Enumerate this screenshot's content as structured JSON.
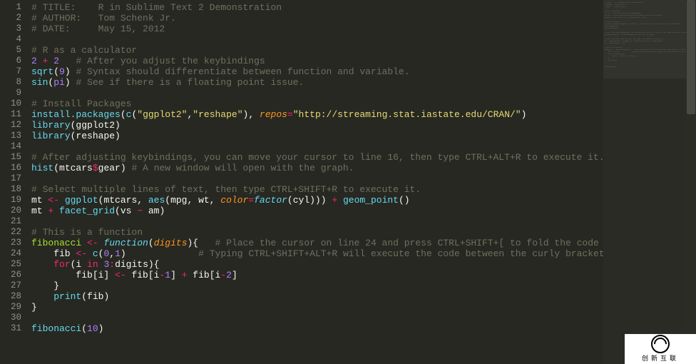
{
  "watermark_text": "创新互联",
  "lines": [
    {
      "n": 1,
      "tokens": [
        [
          "c",
          "# TITLE:    R in Sublime Text 2 Demonstration"
        ]
      ]
    },
    {
      "n": 2,
      "tokens": [
        [
          "c",
          "# AUTHOR:   Tom Schenk Jr."
        ]
      ]
    },
    {
      "n": 3,
      "tokens": [
        [
          "c",
          "# DATE:     May 15, 2012"
        ]
      ]
    },
    {
      "n": 4,
      "tokens": []
    },
    {
      "n": 5,
      "tokens": [
        [
          "c",
          "# R as a calculator"
        ]
      ]
    },
    {
      "n": 6,
      "tokens": [
        [
          "n",
          "2"
        ],
        [
          "p",
          " "
        ],
        [
          "o",
          "+"
        ],
        [
          "p",
          " "
        ],
        [
          "n",
          "2"
        ],
        [
          "p",
          "   "
        ],
        [
          "c",
          "# After you adjust the keybindings"
        ]
      ]
    },
    {
      "n": 7,
      "tokens": [
        [
          "f",
          "sqrt"
        ],
        [
          "p",
          "("
        ],
        [
          "n",
          "9"
        ],
        [
          "p",
          ") "
        ],
        [
          "c",
          "# Syntax should differentiate between function and variable."
        ]
      ]
    },
    {
      "n": 8,
      "tokens": [
        [
          "f",
          "sin"
        ],
        [
          "p",
          "("
        ],
        [
          "n",
          "pi"
        ],
        [
          "p",
          ") "
        ],
        [
          "c",
          "# See if there is a floating point issue."
        ]
      ]
    },
    {
      "n": 9,
      "tokens": []
    },
    {
      "n": 10,
      "tokens": [
        [
          "c",
          "# Install Packages"
        ]
      ]
    },
    {
      "n": 11,
      "tokens": [
        [
          "f",
          "install.packages"
        ],
        [
          "p",
          "("
        ],
        [
          "f",
          "c"
        ],
        [
          "p",
          "("
        ],
        [
          "s",
          "\"ggplot2\""
        ],
        [
          "p",
          ","
        ],
        [
          "s",
          "\"reshape\""
        ],
        [
          "p",
          "), "
        ],
        [
          "pa",
          "repos"
        ],
        [
          "o",
          "="
        ],
        [
          "s",
          "\"http://streaming.stat.iastate.edu/CRAN/\""
        ],
        [
          "p",
          ")"
        ]
      ]
    },
    {
      "n": 12,
      "tokens": [
        [
          "f",
          "library"
        ],
        [
          "p",
          "(ggplot2)"
        ]
      ]
    },
    {
      "n": 13,
      "tokens": [
        [
          "f",
          "library"
        ],
        [
          "p",
          "(reshape)"
        ]
      ]
    },
    {
      "n": 14,
      "tokens": []
    },
    {
      "n": 15,
      "tokens": [
        [
          "c",
          "# After adjusting keybindings, you can move your cursor to line 16, then type CTRL+ALT+R to execute it."
        ]
      ]
    },
    {
      "n": 16,
      "tokens": [
        [
          "f",
          "hist"
        ],
        [
          "p",
          "(mtcars"
        ],
        [
          "o",
          "$"
        ],
        [
          "p",
          "gear) "
        ],
        [
          "c",
          "# A new window will open with the graph."
        ]
      ]
    },
    {
      "n": 17,
      "tokens": []
    },
    {
      "n": 18,
      "tokens": [
        [
          "c",
          "# Select multiple lines of text, then type CTRL+SHIFT+R to execute it."
        ]
      ]
    },
    {
      "n": 19,
      "tokens": [
        [
          "p",
          "mt "
        ],
        [
          "o",
          "<-"
        ],
        [
          "p",
          " "
        ],
        [
          "f",
          "ggplot"
        ],
        [
          "p",
          "(mtcars, "
        ],
        [
          "f",
          "aes"
        ],
        [
          "p",
          "(mpg, wt, "
        ],
        [
          "pa",
          "color"
        ],
        [
          "o",
          "="
        ],
        [
          "t",
          "factor"
        ],
        [
          "p",
          "(cyl))) "
        ],
        [
          "o",
          "+"
        ],
        [
          "p",
          " "
        ],
        [
          "f",
          "geom_point"
        ],
        [
          "p",
          "()"
        ]
      ]
    },
    {
      "n": 20,
      "tokens": [
        [
          "p",
          "mt "
        ],
        [
          "o",
          "+"
        ],
        [
          "p",
          " "
        ],
        [
          "f",
          "facet_grid"
        ],
        [
          "p",
          "(vs "
        ],
        [
          "o",
          "~"
        ],
        [
          "p",
          " am)"
        ]
      ]
    },
    {
      "n": 21,
      "tokens": []
    },
    {
      "n": 22,
      "tokens": [
        [
          "c",
          "# This is a function"
        ]
      ]
    },
    {
      "n": 23,
      "tokens": [
        [
          "d",
          "fibonacci"
        ],
        [
          "p",
          " "
        ],
        [
          "o",
          "<-"
        ],
        [
          "p",
          " "
        ],
        [
          "t",
          "function"
        ],
        [
          "p",
          "("
        ],
        [
          "pa",
          "digits"
        ],
        [
          "p",
          "){   "
        ],
        [
          "c",
          "# Place the cursor on line 24 and press CTRL+SHIFT+[ to fold the code"
        ]
      ]
    },
    {
      "n": 24,
      "tokens": [
        [
          "p",
          "    fib "
        ],
        [
          "o",
          "<-"
        ],
        [
          "p",
          " "
        ],
        [
          "f",
          "c"
        ],
        [
          "p",
          "("
        ],
        [
          "n",
          "0"
        ],
        [
          "p",
          ","
        ],
        [
          "n",
          "1"
        ],
        [
          "p",
          ")             "
        ],
        [
          "c",
          "# Typing CTRL+SHIFT+ALT+R will execute the code between the curly brackets."
        ]
      ]
    },
    {
      "n": 25,
      "tokens": [
        [
          "p",
          "    "
        ],
        [
          "k",
          "for"
        ],
        [
          "p",
          "(i "
        ],
        [
          "k",
          "in"
        ],
        [
          "p",
          " "
        ],
        [
          "n",
          "3"
        ],
        [
          "o",
          ":"
        ],
        [
          "p",
          "digits){"
        ]
      ]
    },
    {
      "n": 26,
      "tokens": [
        [
          "p",
          "        fib[i] "
        ],
        [
          "o",
          "<-"
        ],
        [
          "p",
          " fib[i"
        ],
        [
          "o",
          "-"
        ],
        [
          "n",
          "1"
        ],
        [
          "p",
          "] "
        ],
        [
          "o",
          "+"
        ],
        [
          "p",
          " fib[i"
        ],
        [
          "o",
          "-"
        ],
        [
          "n",
          "2"
        ],
        [
          "p",
          "]"
        ]
      ]
    },
    {
      "n": 27,
      "tokens": [
        [
          "p",
          "    }"
        ]
      ]
    },
    {
      "n": 28,
      "tokens": [
        [
          "p",
          "    "
        ],
        [
          "f",
          "print"
        ],
        [
          "p",
          "(fib)"
        ]
      ]
    },
    {
      "n": 29,
      "tokens": [
        [
          "p",
          "}"
        ]
      ]
    },
    {
      "n": 30,
      "tokens": []
    },
    {
      "n": 31,
      "tokens": [
        [
          "f",
          "fibonacci"
        ],
        [
          "p",
          "("
        ],
        [
          "n",
          "10"
        ],
        [
          "p",
          ")"
        ]
      ]
    }
  ]
}
